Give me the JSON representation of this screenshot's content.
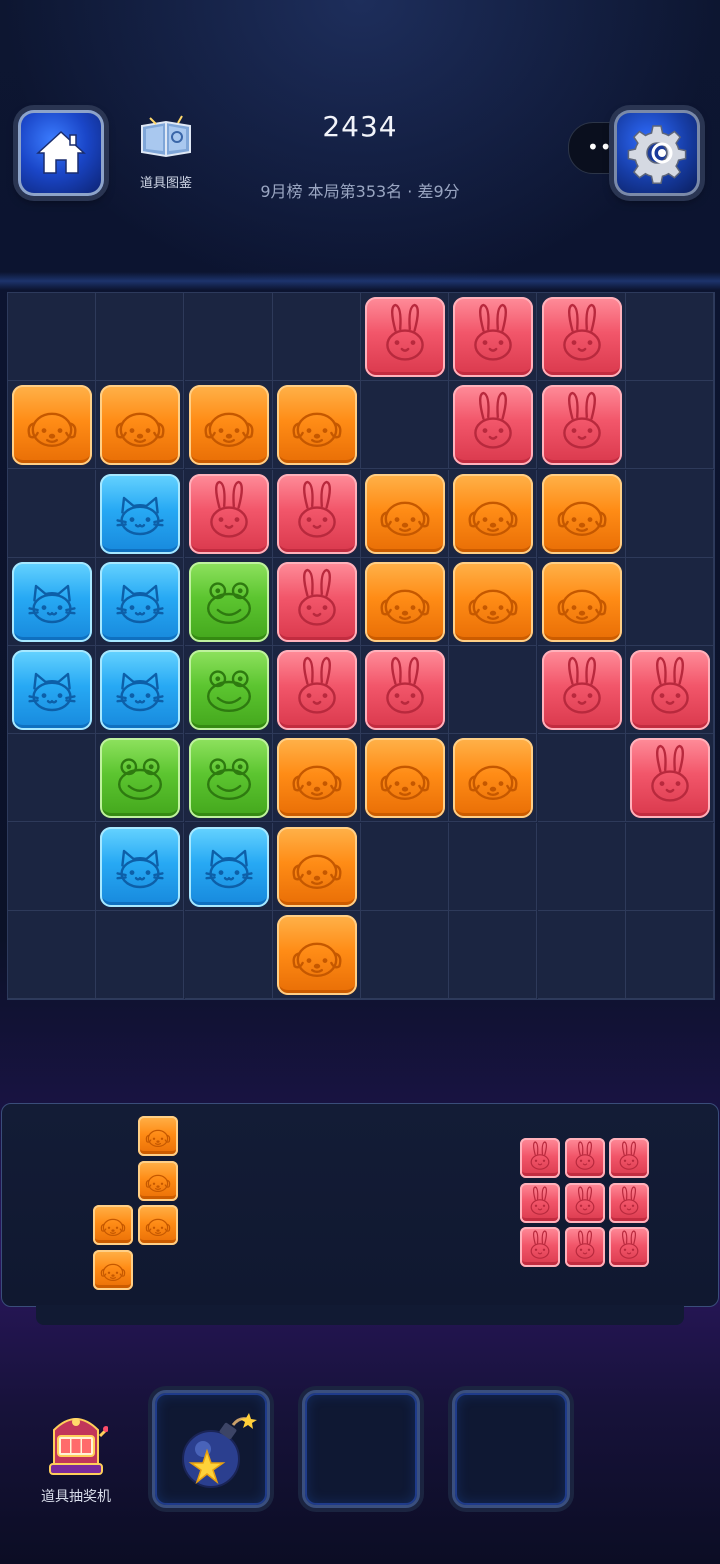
{
  "header": {
    "score": "2434",
    "rank_text": "9月榜 本局第353名 · 差9分",
    "catalog_label": "道具图鉴"
  },
  "board": {
    "rows": 8,
    "cols": 8,
    "grid": [
      [
        null,
        null,
        null,
        null,
        "rabbit",
        "rabbit",
        "rabbit",
        null
      ],
      [
        "dog",
        "dog",
        "dog",
        "dog",
        null,
        "rabbit",
        "rabbit",
        null
      ],
      [
        null,
        "cat",
        "rabbit",
        "rabbit",
        "dog",
        "dog",
        "dog",
        null
      ],
      [
        "cat",
        "cat",
        "frog",
        "rabbit",
        "dog",
        "dog",
        "dog",
        null
      ],
      [
        "cat",
        "cat",
        "frog",
        "rabbit",
        "rabbit",
        null,
        "rabbit",
        "rabbit"
      ],
      [
        null,
        "frog",
        "frog",
        "dog",
        "dog",
        "dog",
        null,
        "rabbit"
      ],
      [
        null,
        "cat",
        "cat",
        "dog",
        null,
        null,
        null,
        null
      ],
      [
        null,
        null,
        null,
        "dog",
        null,
        null,
        null,
        null
      ]
    ]
  },
  "tray": {
    "pieces": [
      {
        "animal": "dog",
        "cells": [
          [
            0,
            1
          ],
          [
            1,
            1
          ],
          [
            2,
            0
          ],
          [
            2,
            1
          ],
          [
            3,
            0
          ]
        ]
      },
      {
        "animal": "rabbit",
        "cells": [
          [
            0,
            0
          ],
          [
            0,
            1
          ],
          [
            0,
            2
          ],
          [
            1,
            0
          ],
          [
            1,
            1
          ],
          [
            1,
            2
          ],
          [
            2,
            0
          ],
          [
            2,
            1
          ],
          [
            2,
            2
          ]
        ]
      }
    ]
  },
  "bottom": {
    "slot_machine_label": "道具抽奖机",
    "item_slots": [
      "bomb-icon",
      "empty",
      "empty"
    ]
  },
  "colors": {
    "rabbit": "#f2566a",
    "dog": "#ff8c16",
    "cat": "#27a9f4",
    "frog": "#5cc530"
  }
}
